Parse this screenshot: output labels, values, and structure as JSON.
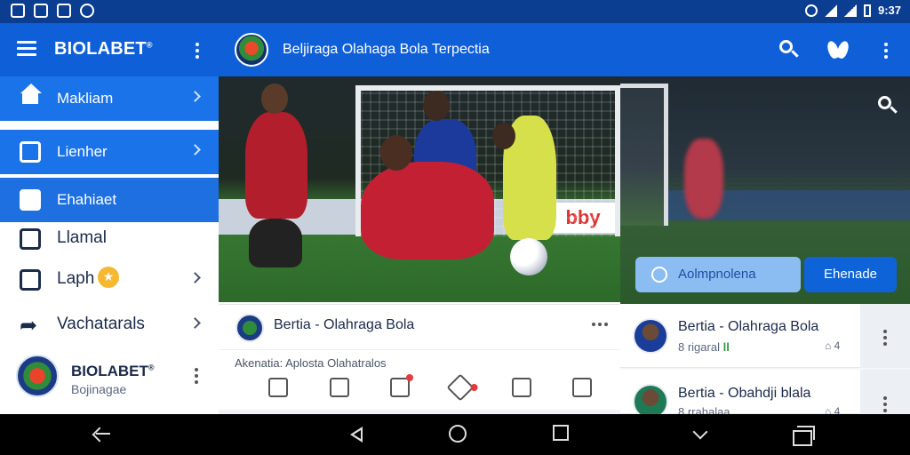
{
  "status_bar": {
    "time": "9:37",
    "left_icons": [
      "gallery-icon",
      "message-icon",
      "photo-icon",
      "app-icon"
    ],
    "right_icons": [
      "alarm-icon",
      "wifi-icon",
      "signal-icon",
      "battery-icon"
    ]
  },
  "appbar": {
    "brand": "BIOLABET",
    "brand_mark": "®",
    "title": "Beljiraga Olahaga Bola Terpectia"
  },
  "drawer": {
    "items": [
      {
        "label": "Makliam",
        "icon": "home-icon",
        "style": "blue"
      },
      {
        "label": "Lienher",
        "icon": "calendar-icon",
        "style": "blue"
      },
      {
        "label": "Ehahiaet",
        "icon": "edit-icon",
        "style": "active"
      },
      {
        "label": "Llamal",
        "icon": "inbox-icon",
        "style": "white"
      },
      {
        "label": "Laph",
        "icon": "store-icon",
        "style": "white",
        "badge_icon": "trophy-icon"
      },
      {
        "label": "Vachatarals",
        "icon": "share-icon",
        "style": "white"
      }
    ],
    "profile": {
      "name": "BIOLABET",
      "name_mark": "®",
      "subtitle": "Bojinagae"
    }
  },
  "hero": {
    "ad_text": "bby"
  },
  "right_panel": {
    "button_primary": "Aolmpnolena",
    "button_secondary": "Ehenade"
  },
  "post": {
    "title": "Bertia - Olahraga Bola",
    "subtitle": "Akenatia: Aplosta  Olahatralos",
    "actions": [
      "like-icon",
      "comment-icon",
      "share-icon",
      "pin-icon",
      "media-icon",
      "bookmark-icon"
    ]
  },
  "right_list": [
    {
      "title": "Bertia - Olahraga Bola",
      "meta": "8 rigaral",
      "meta_tag": "ll",
      "stat": "4"
    },
    {
      "title": "Bertia - Obahdji blala",
      "meta": "8 rrahalaa",
      "meta_tag": "",
      "stat": "4"
    }
  ],
  "colors": {
    "status_bar": "#0b3d91",
    "appbar": "#0f5fd8",
    "drawer_blue": "#1a73e8",
    "accent_button": "#0e63d8",
    "light_button": "#8cbdf2"
  }
}
